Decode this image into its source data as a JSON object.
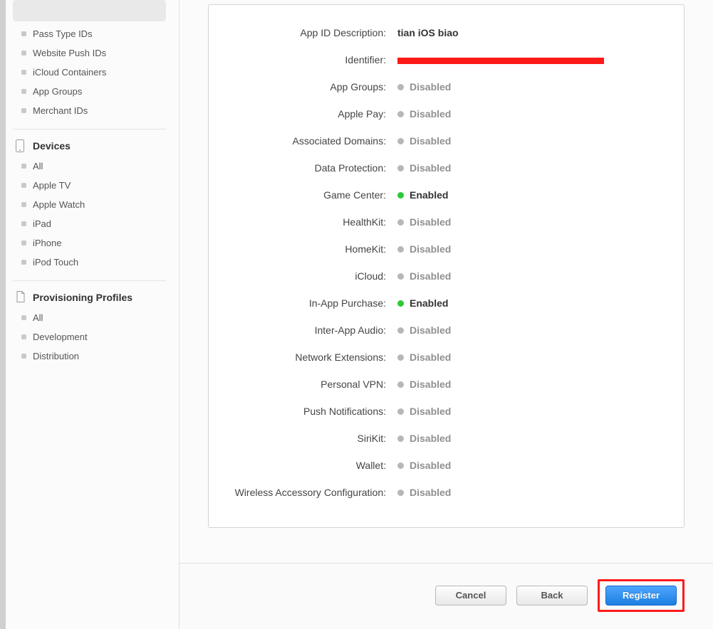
{
  "sidebar": {
    "identifiers_items": [
      "Pass Type IDs",
      "Website Push IDs",
      "iCloud Containers",
      "App Groups",
      "Merchant IDs"
    ],
    "devices": {
      "title": "Devices",
      "items": [
        "All",
        "Apple TV",
        "Apple Watch",
        "iPad",
        "iPhone",
        "iPod Touch"
      ]
    },
    "profiles": {
      "title": "Provisioning Profiles",
      "items": [
        "All",
        "Development",
        "Distribution"
      ]
    }
  },
  "summary": {
    "description_label": "App ID Description:",
    "description_value": "tian iOS biao",
    "identifier_label": "Identifier:",
    "services": [
      {
        "label": "App Groups:",
        "status": "Disabled"
      },
      {
        "label": "Apple Pay:",
        "status": "Disabled"
      },
      {
        "label": "Associated Domains:",
        "status": "Disabled"
      },
      {
        "label": "Data Protection:",
        "status": "Disabled"
      },
      {
        "label": "Game Center:",
        "status": "Enabled"
      },
      {
        "label": "HealthKit:",
        "status": "Disabled"
      },
      {
        "label": "HomeKit:",
        "status": "Disabled"
      },
      {
        "label": "iCloud:",
        "status": "Disabled"
      },
      {
        "label": "In-App Purchase:",
        "status": "Enabled"
      },
      {
        "label": "Inter-App Audio:",
        "status": "Disabled"
      },
      {
        "label": "Network Extensions:",
        "status": "Disabled"
      },
      {
        "label": "Personal VPN:",
        "status": "Disabled"
      },
      {
        "label": "Push Notifications:",
        "status": "Disabled"
      },
      {
        "label": "SiriKit:",
        "status": "Disabled"
      },
      {
        "label": "Wallet:",
        "status": "Disabled"
      },
      {
        "label": "Wireless Accessory Configuration:",
        "status": "Disabled"
      }
    ]
  },
  "buttons": {
    "cancel": "Cancel",
    "back": "Back",
    "register": "Register"
  }
}
